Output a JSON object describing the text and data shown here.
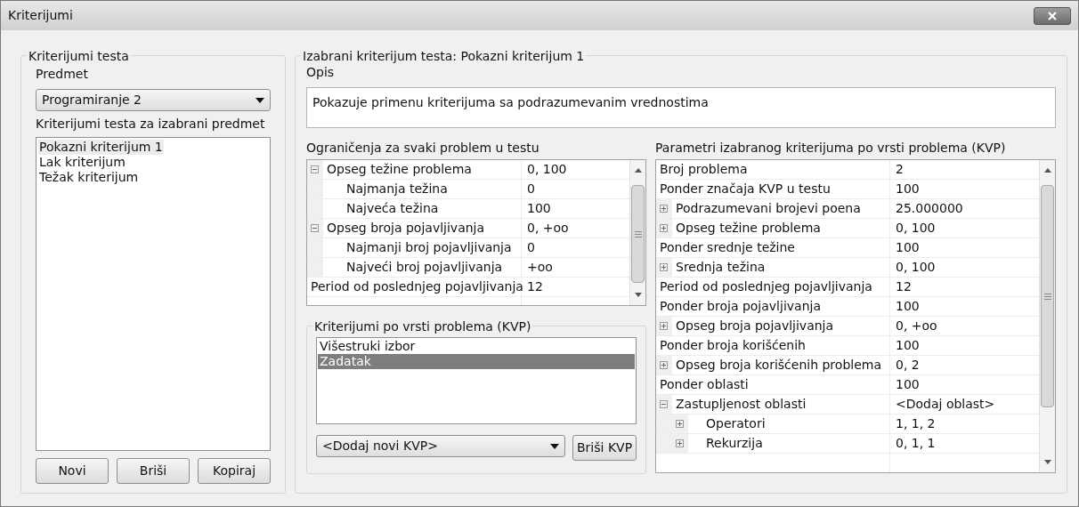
{
  "window": {
    "title": "Kriterijumi"
  },
  "left_group": {
    "title": "Kriterijumi testa",
    "subject_label": "Predmet",
    "subject_value": "Programiranje 2",
    "list_label": "Kriterijumi testa za izabrani predmet",
    "items": [
      {
        "label": "Pokazni kriterijum 1",
        "selected": true
      },
      {
        "label": "Lak kriterijum",
        "selected": false
      },
      {
        "label": "Težak kriterijum",
        "selected": false
      }
    ],
    "buttons": [
      "Novi",
      "Briši",
      "Kopiraj"
    ]
  },
  "right_group": {
    "title": "Izabrani kriterijum testa: Pokazni kriterijum 1",
    "description_label": "Opis",
    "description": "Pokazuje primenu kriterijuma sa podrazumevanim vrednostima",
    "constraints": {
      "title": "Ograničenja za svaki problem u testu",
      "rows": [
        {
          "name": "Opseg težine problema",
          "value": "0, 100",
          "expanded": true,
          "children": [
            {
              "name": "Najmanja težina",
              "value": "0"
            },
            {
              "name": "Najveća težina",
              "value": "100"
            }
          ]
        },
        {
          "name": "Opseg broja pojavljivanja",
          "value": "0, +oo",
          "expanded": true,
          "children": [
            {
              "name": "Najmanji broj pojavljivanja",
              "value": "0"
            },
            {
              "name": "Najveći broj pojavljivanja",
              "value": "+oo"
            }
          ]
        },
        {
          "name": "Period od poslednjeg pojavljivanja",
          "value": "12"
        }
      ]
    },
    "kvp": {
      "title": "Kriterijumi po vrsti problema (KVP)",
      "items": [
        {
          "label": "Višestruki izbor",
          "selected": false
        },
        {
          "label": "Zadatak",
          "selected": true
        }
      ],
      "add_value": "<Dodaj novi KVP>",
      "delete_button": "Briši KVP"
    },
    "parameters": {
      "title": "Parametri izabranog kriterijuma po vrsti problema (KVP)",
      "rows": [
        {
          "name": "Broj problema",
          "value": "2"
        },
        {
          "name": "Ponder značaja KVP u testu",
          "value": "100"
        },
        {
          "name": "Podrazumevani brojevi poena",
          "value": "25.000000",
          "expanded": false
        },
        {
          "name": "Opseg težine problema",
          "value": "0, 100",
          "expanded": false
        },
        {
          "name": "Ponder srednje težine",
          "value": "100"
        },
        {
          "name": "Srednja težina",
          "value": "0, 100",
          "expanded": false
        },
        {
          "name": "Period od poslednjeg pojavljivanja",
          "value": "12"
        },
        {
          "name": "Ponder broja pojavljivanja",
          "value": "100"
        },
        {
          "name": "Opseg broja pojavljivanja",
          "value": "0, +oo",
          "expanded": false
        },
        {
          "name": "Ponder broja korišćenih",
          "value": "100"
        },
        {
          "name": "Opseg broja korišćenih problema",
          "value": "0, 2",
          "expanded": false
        },
        {
          "name": "Ponder oblasti",
          "value": "100"
        },
        {
          "name": "Zastupljenost oblasti",
          "value": "<Dodaj oblast>",
          "expanded": true,
          "children": [
            {
              "name": "Operatori",
              "value": "1, 1, 2",
              "expanded": false
            },
            {
              "name": "Rekurzija",
              "value": "0, 1, 1",
              "expanded": false
            }
          ]
        }
      ]
    }
  }
}
